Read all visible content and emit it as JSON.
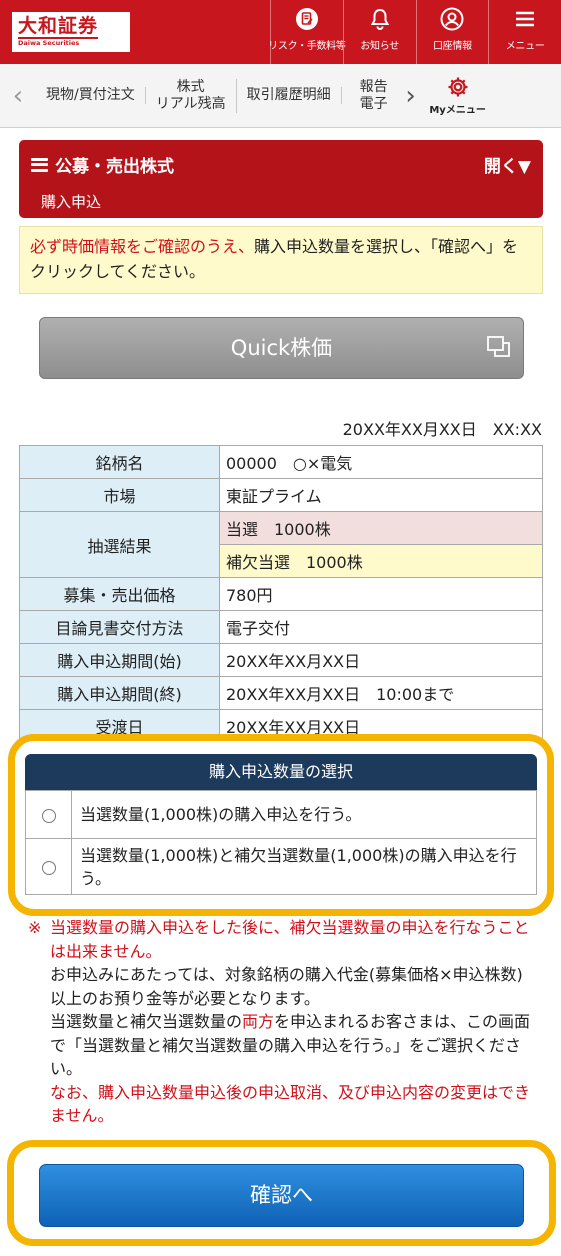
{
  "header": {
    "logo_jp": "大和証券",
    "logo_en": "Daiwa Securities",
    "buttons": [
      {
        "label": "リスク・手数料等",
        "icon": "document-icon"
      },
      {
        "label": "お知らせ",
        "icon": "bell-icon"
      },
      {
        "label": "口座情報",
        "icon": "user-icon"
      },
      {
        "label": "メニュー",
        "icon": "hamburger-icon"
      }
    ]
  },
  "nav": {
    "items": [
      "現物/買付注文",
      "株式\nリアル残高",
      "取引履歴明細",
      "報告\n電子"
    ],
    "my_menu": "Myメニュー"
  },
  "section": {
    "title": "公募・売出株式",
    "open_label": "開く▼",
    "subtitle": "購入申込"
  },
  "notice": {
    "red_text": "必ず時価情報をご確認のうえ、",
    "text": "購入申込数量を選択し、「確認へ」をクリックしてください。"
  },
  "quick_button": "Quick株価",
  "datetime": "20XX年XX月XX日　XX:XX",
  "info": {
    "rows": [
      {
        "label": "銘柄名",
        "value": "00000　○×電気"
      },
      {
        "label": "市場",
        "value": "東証プライム"
      },
      {
        "label": "抽選結果",
        "value": "当選　1000株",
        "value2": "補欠当選　1000株"
      },
      {
        "label": "募集・売出価格",
        "value": "780円"
      },
      {
        "label": "目論見書交付方法",
        "value": "電子交付"
      },
      {
        "label": "購入申込期間(始)",
        "value": "20XX年XX月XX日"
      },
      {
        "label": "購入申込期間(終)",
        "value": "20XX年XX月XX日　10:00まで"
      },
      {
        "label": "受渡日",
        "value": "20XX年XX月XX日"
      }
    ]
  },
  "quantity": {
    "header": "購入申込数量の選択",
    "options": [
      "当選数量(1,000株)の購入申込を行う。",
      "当選数量(1,000株)と補欠当選数量(1,000株)の購入申込を行う。"
    ]
  },
  "notes": {
    "mark": "※",
    "line1": "当選数量の購入申込をした後に、補欠当選数量の申込を行なうことは出来ません。",
    "line2": "お申込みにあたっては、対象銘柄の購入代金(募集価格×申込株数)以上のお預り金等が必要となります。",
    "line3_a": "当選数量と補欠当選数量の",
    "line3_red": "両方",
    "line3_b": "を申込まれるお客さまは、この画面で「当選数量と補欠当選数量の購入申込を行う。」をご選択ください。",
    "line4": "なお、購入申込数量申込後の申込取消、及び申込内容の変更はできません。"
  },
  "confirm_button": "確認へ",
  "colors": {
    "brand_red": "#c8161e",
    "highlight": "#f5b400",
    "navy": "#1c3a5c",
    "button_blue": "#1f7bd0"
  }
}
